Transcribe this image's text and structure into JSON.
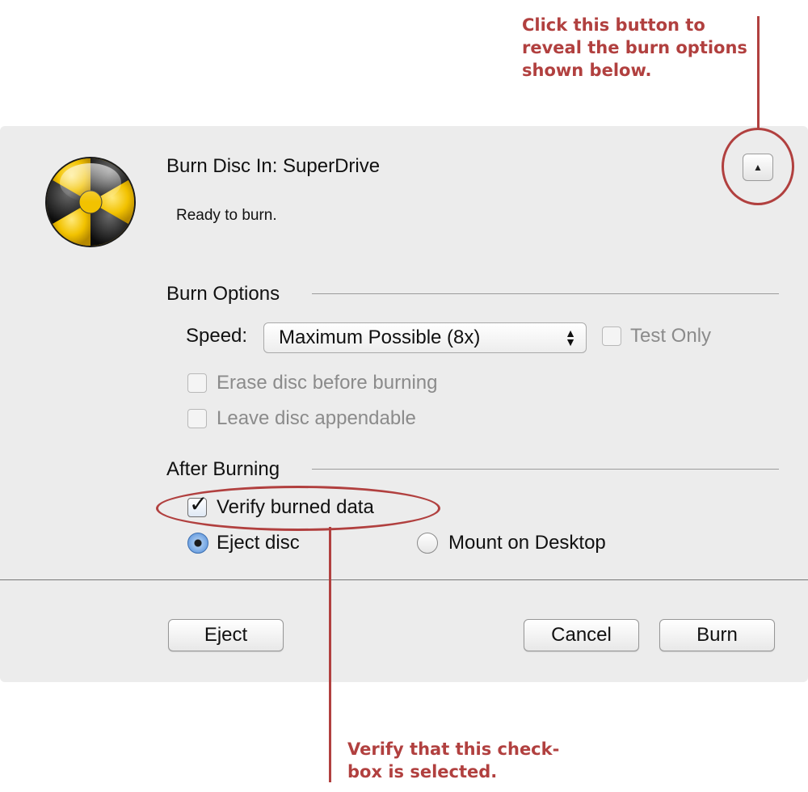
{
  "annotations": {
    "top": "Click this button to\nreveal the burn options\nshown below.",
    "bottom": "Verify that this check-\nbox is selected."
  },
  "dialog": {
    "title": "Burn Disc In:  SuperDrive",
    "status": "Ready to burn.",
    "disclosure_glyph": "▲",
    "burn_options": {
      "heading": "Burn Options",
      "speed_label": "Speed:",
      "speed_value": "Maximum Possible (8x)",
      "test_only": {
        "label": "Test Only",
        "checked": false,
        "enabled": false
      },
      "erase": {
        "label": "Erase disc before burning",
        "checked": false,
        "enabled": false
      },
      "appendable": {
        "label": "Leave disc appendable",
        "checked": false,
        "enabled": false
      }
    },
    "after_burning": {
      "heading": "After Burning",
      "verify": {
        "label": "Verify burned data",
        "checked": true
      },
      "eject_radio": {
        "label": "Eject disc",
        "selected": true
      },
      "mount_radio": {
        "label": "Mount on Desktop",
        "selected": false
      }
    },
    "buttons": {
      "eject": "Eject",
      "cancel": "Cancel",
      "burn": "Burn"
    }
  },
  "colors": {
    "annotation": "#b1403f",
    "dialog_bg": "#ececec",
    "radiation_yellow": "#f2c200"
  },
  "icons": {
    "app_icon": "radiation-burn-icon",
    "disclosure": "triangle-up-icon",
    "select_arrows": "up-down-arrows-icon",
    "checkmark": "checkmark-icon"
  }
}
